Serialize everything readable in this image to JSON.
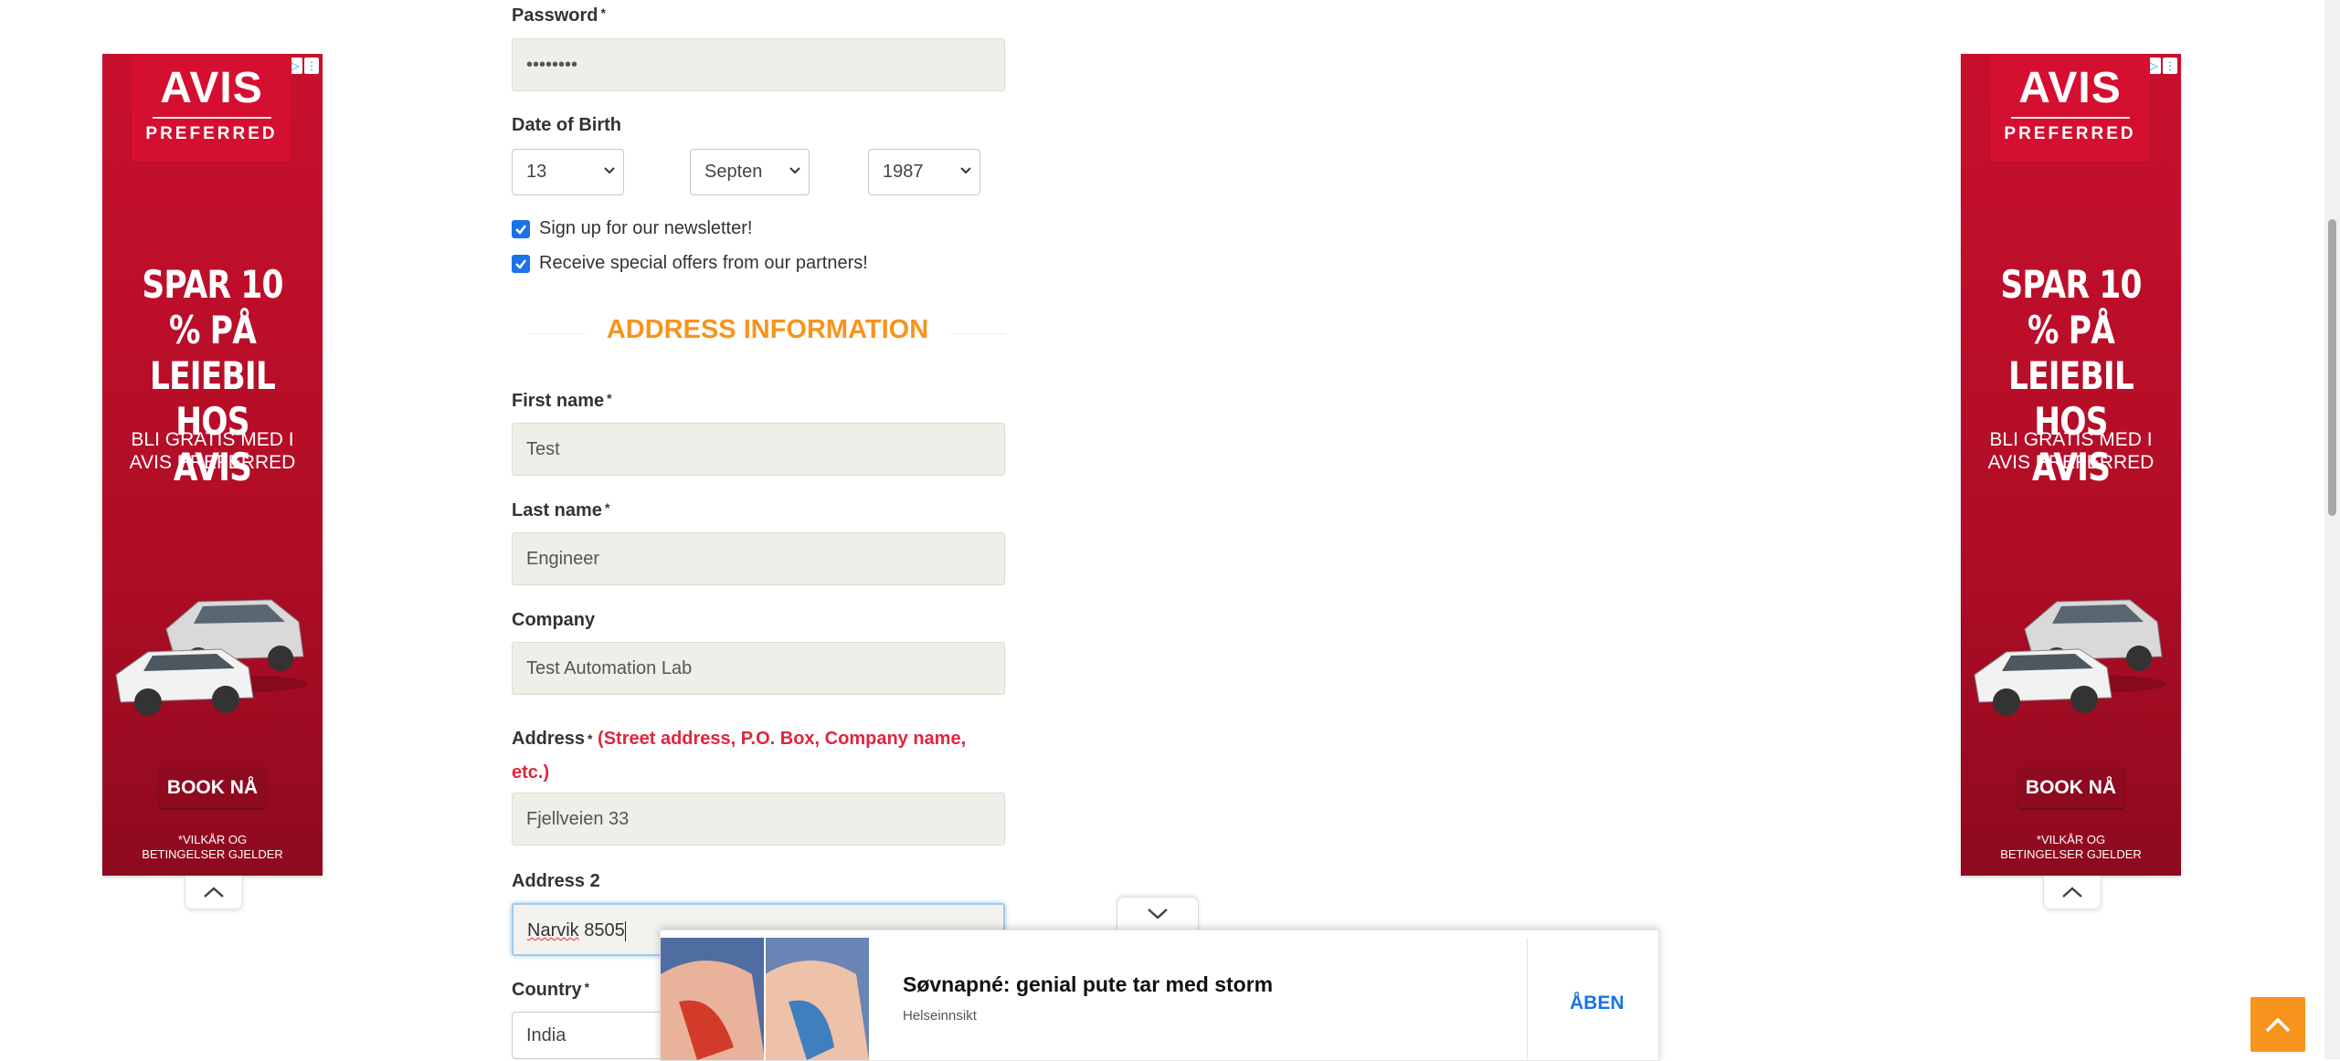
{
  "form": {
    "password": {
      "label": "Password",
      "required": "*",
      "value": "••••••••"
    },
    "dob": {
      "label": "Date of Birth",
      "day": "13",
      "month": "Septen",
      "year": "1987"
    },
    "newsletter": {
      "label": "Sign up for our newsletter!",
      "checked": true
    },
    "offers": {
      "label": "Receive special offers from our partners!",
      "checked": true
    },
    "address_section_title": "ADDRESS INFORMATION",
    "first_name": {
      "label": "First name",
      "required": "*",
      "value": "Test"
    },
    "last_name": {
      "label": "Last name",
      "required": "*",
      "value": "Engineer"
    },
    "company": {
      "label": "Company",
      "value": "Test Automation Lab"
    },
    "address": {
      "label": "Address",
      "required": "*",
      "hint_line1": "(Street address, P.O. Box, Company name,",
      "hint_line2": "etc.)",
      "value": "Fjellveien 33"
    },
    "address2": {
      "label": "Address 2",
      "value_word": "Narvik",
      "value_rest": " 8505"
    },
    "country": {
      "label": "Country",
      "required": "*",
      "value": "India"
    }
  },
  "side_ad": {
    "brand": "AVIS",
    "brand_sub": "PREFERRED",
    "headline_1": "SPAR 10 % PÅ",
    "headline_2": "LEIEBIL HOS",
    "headline_3": "AVIS",
    "sub_1": "BLI GRATIS MED I",
    "sub_2": "AVIS PREFERRED",
    "button": "BOOK NÅ",
    "terms_1": "*VILKÅR OG",
    "terms_2": "BETINGELSER GJELDER",
    "colors": {
      "primary": "#c8102e",
      "dark": "#8e0a1f"
    }
  },
  "native_ad": {
    "title": "Søvnapné: genial pute tar med storm",
    "source": "Helseinnsikt",
    "cta": "ÅBEN"
  },
  "icons": [
    "chevron-up-icon",
    "chevron-down-icon",
    "adchoices-icon",
    "ad-menu-icon",
    "check-icon",
    "arrow-up-icon"
  ],
  "colors": {
    "accent": "#f7941d",
    "error": "#e0253d",
    "link": "#1a73e8"
  }
}
